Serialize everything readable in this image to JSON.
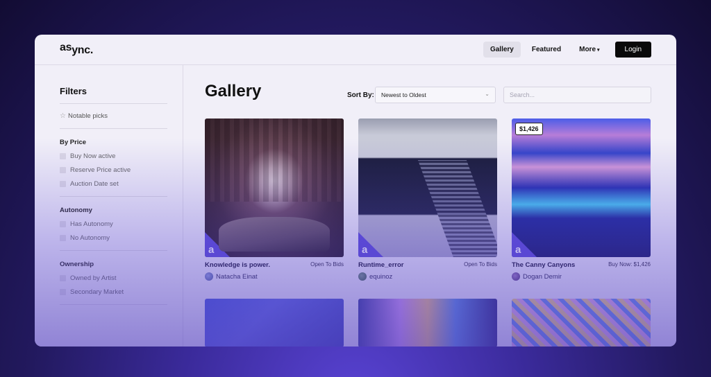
{
  "header": {
    "logo_top": "as",
    "logo_bottom": "ync.",
    "nav": [
      {
        "label": "Gallery",
        "active": true
      },
      {
        "label": "Featured",
        "active": false
      },
      {
        "label": "More",
        "active": false
      }
    ],
    "more_caret": "▾",
    "login_label": "Login"
  },
  "sidebar": {
    "title": "Filters",
    "notable_icon": "☆",
    "notable_label": "Notable picks",
    "groups": [
      {
        "title": "By Price",
        "options": [
          "Buy Now active",
          "Reserve Price active",
          "Auction Date set"
        ]
      },
      {
        "title": "Autonomy",
        "options": [
          "Has Autonomy",
          "No Autonomy"
        ]
      },
      {
        "title": "Ownership",
        "options": [
          "Owned by Artist",
          "Secondary Market"
        ]
      }
    ]
  },
  "main": {
    "title": "Gallery",
    "sort_label": "Sort By:",
    "sort_value": "Newest to Oldest",
    "sort_chevron": "⌄",
    "search_placeholder": "Search...",
    "corner_logo": "a",
    "cards": [
      {
        "title": "Knowledge is power.",
        "status": "Open To Bids",
        "artist": "Natacha Einat",
        "avatar_color": "#6a7ab8"
      },
      {
        "title": "Runtime_error",
        "status": "Open To Bids",
        "artist": "equinoz",
        "avatar_color": "#4a6a5a"
      },
      {
        "title": "The Canny Canyons",
        "status": "Buy Now: $1,426",
        "artist": "Dogan Demir",
        "avatar_color": "#6a4a8a",
        "price_tag": "$1,426"
      }
    ]
  }
}
